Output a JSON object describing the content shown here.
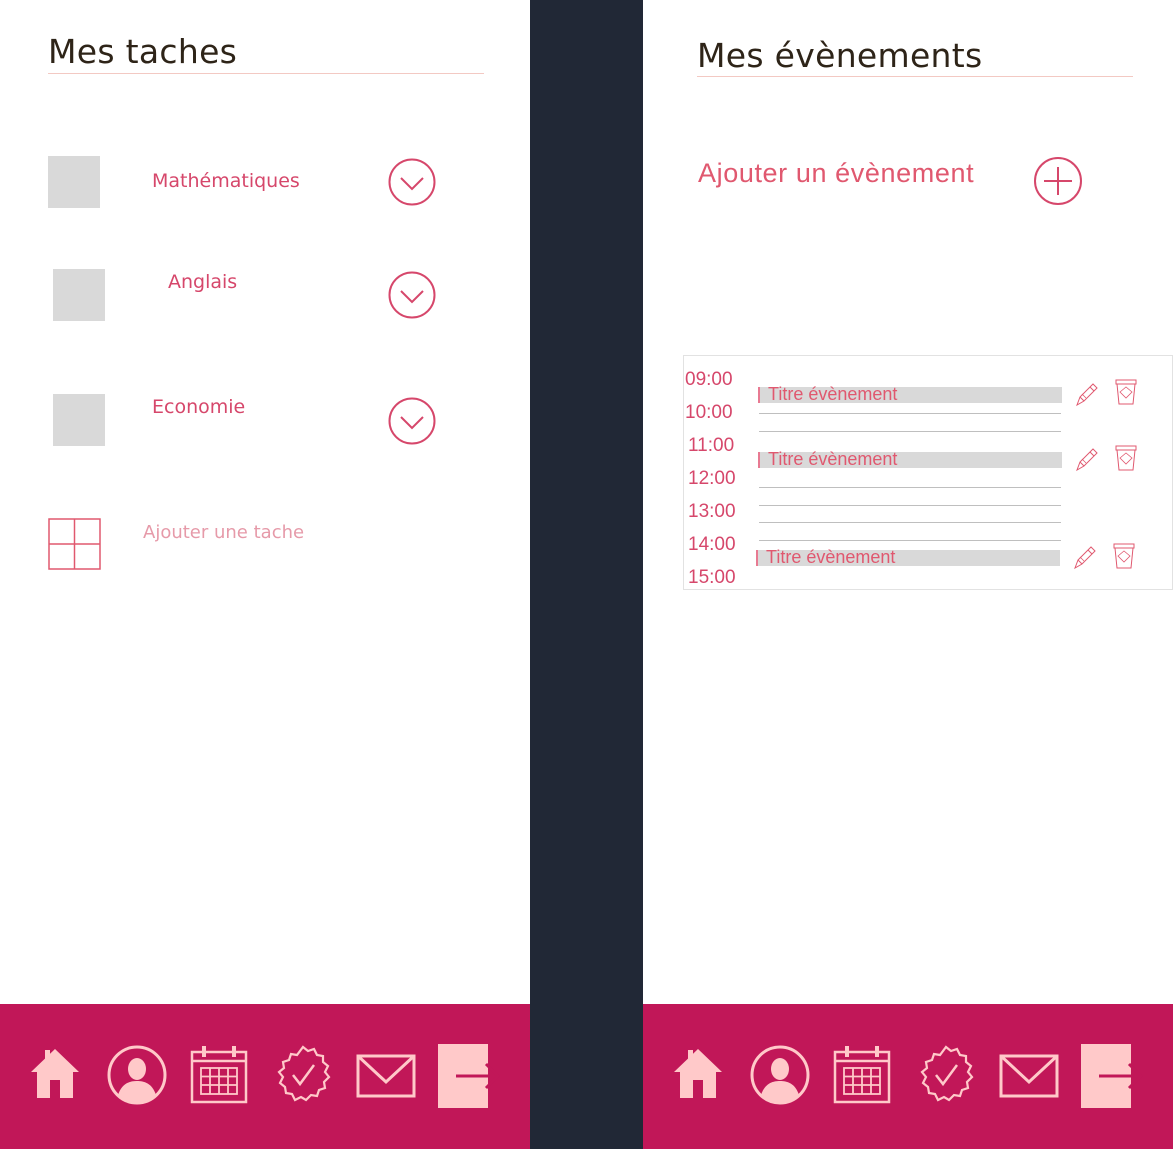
{
  "tasks_screen": {
    "title": "Mes taches",
    "tasks": [
      {
        "label": "Mathématiques"
      },
      {
        "label": "Anglais"
      },
      {
        "label": "Economie"
      }
    ],
    "add_label": "Ajouter une tache"
  },
  "events_screen": {
    "title": "Mes évènements",
    "add_label": "Ajouter un évènement",
    "hours": [
      "09:00",
      "10:00",
      "11:00",
      "12:00",
      "13:00",
      "14:00",
      "15:00"
    ],
    "events": [
      {
        "title": "Titre évènement"
      },
      {
        "title": "Titre évènement"
      },
      {
        "title": "Titre évènement"
      }
    ]
  },
  "nav": {
    "items": [
      "home-icon",
      "profile-icon",
      "calendar-icon",
      "tasks-check-icon",
      "mail-icon",
      "logout-icon"
    ]
  },
  "colors": {
    "accent": "#c11758",
    "text_pink": "#d6476b",
    "icon_pink": "#ffc9c9",
    "divider": "#212836",
    "checkbox_grey": "#d9d9d9"
  }
}
